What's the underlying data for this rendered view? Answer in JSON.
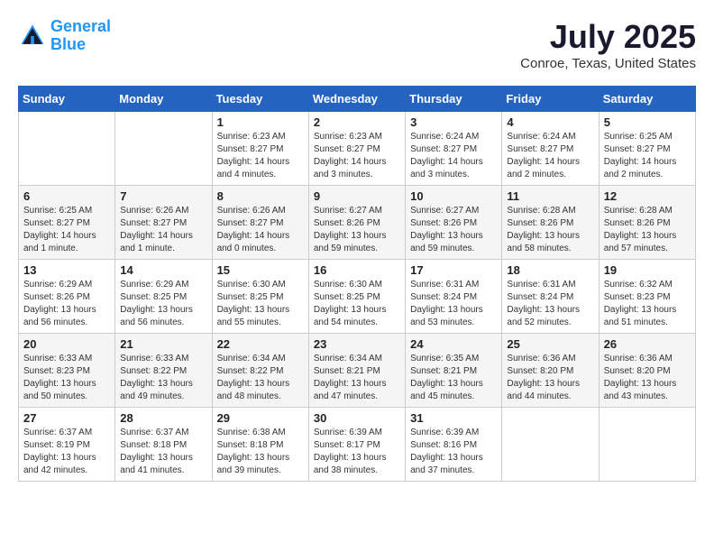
{
  "header": {
    "logo_line1": "General",
    "logo_line2": "Blue",
    "month_year": "July 2025",
    "location": "Conroe, Texas, United States"
  },
  "weekdays": [
    "Sunday",
    "Monday",
    "Tuesday",
    "Wednesday",
    "Thursday",
    "Friday",
    "Saturday"
  ],
  "weeks": [
    [
      {
        "day": "",
        "text": ""
      },
      {
        "day": "",
        "text": ""
      },
      {
        "day": "1",
        "text": "Sunrise: 6:23 AM\nSunset: 8:27 PM\nDaylight: 14 hours and 4 minutes."
      },
      {
        "day": "2",
        "text": "Sunrise: 6:23 AM\nSunset: 8:27 PM\nDaylight: 14 hours and 3 minutes."
      },
      {
        "day": "3",
        "text": "Sunrise: 6:24 AM\nSunset: 8:27 PM\nDaylight: 14 hours and 3 minutes."
      },
      {
        "day": "4",
        "text": "Sunrise: 6:24 AM\nSunset: 8:27 PM\nDaylight: 14 hours and 2 minutes."
      },
      {
        "day": "5",
        "text": "Sunrise: 6:25 AM\nSunset: 8:27 PM\nDaylight: 14 hours and 2 minutes."
      }
    ],
    [
      {
        "day": "6",
        "text": "Sunrise: 6:25 AM\nSunset: 8:27 PM\nDaylight: 14 hours and 1 minute."
      },
      {
        "day": "7",
        "text": "Sunrise: 6:26 AM\nSunset: 8:27 PM\nDaylight: 14 hours and 1 minute."
      },
      {
        "day": "8",
        "text": "Sunrise: 6:26 AM\nSunset: 8:27 PM\nDaylight: 14 hours and 0 minutes."
      },
      {
        "day": "9",
        "text": "Sunrise: 6:27 AM\nSunset: 8:26 PM\nDaylight: 13 hours and 59 minutes."
      },
      {
        "day": "10",
        "text": "Sunrise: 6:27 AM\nSunset: 8:26 PM\nDaylight: 13 hours and 59 minutes."
      },
      {
        "day": "11",
        "text": "Sunrise: 6:28 AM\nSunset: 8:26 PM\nDaylight: 13 hours and 58 minutes."
      },
      {
        "day": "12",
        "text": "Sunrise: 6:28 AM\nSunset: 8:26 PM\nDaylight: 13 hours and 57 minutes."
      }
    ],
    [
      {
        "day": "13",
        "text": "Sunrise: 6:29 AM\nSunset: 8:26 PM\nDaylight: 13 hours and 56 minutes."
      },
      {
        "day": "14",
        "text": "Sunrise: 6:29 AM\nSunset: 8:25 PM\nDaylight: 13 hours and 56 minutes."
      },
      {
        "day": "15",
        "text": "Sunrise: 6:30 AM\nSunset: 8:25 PM\nDaylight: 13 hours and 55 minutes."
      },
      {
        "day": "16",
        "text": "Sunrise: 6:30 AM\nSunset: 8:25 PM\nDaylight: 13 hours and 54 minutes."
      },
      {
        "day": "17",
        "text": "Sunrise: 6:31 AM\nSunset: 8:24 PM\nDaylight: 13 hours and 53 minutes."
      },
      {
        "day": "18",
        "text": "Sunrise: 6:31 AM\nSunset: 8:24 PM\nDaylight: 13 hours and 52 minutes."
      },
      {
        "day": "19",
        "text": "Sunrise: 6:32 AM\nSunset: 8:23 PM\nDaylight: 13 hours and 51 minutes."
      }
    ],
    [
      {
        "day": "20",
        "text": "Sunrise: 6:33 AM\nSunset: 8:23 PM\nDaylight: 13 hours and 50 minutes."
      },
      {
        "day": "21",
        "text": "Sunrise: 6:33 AM\nSunset: 8:22 PM\nDaylight: 13 hours and 49 minutes."
      },
      {
        "day": "22",
        "text": "Sunrise: 6:34 AM\nSunset: 8:22 PM\nDaylight: 13 hours and 48 minutes."
      },
      {
        "day": "23",
        "text": "Sunrise: 6:34 AM\nSunset: 8:21 PM\nDaylight: 13 hours and 47 minutes."
      },
      {
        "day": "24",
        "text": "Sunrise: 6:35 AM\nSunset: 8:21 PM\nDaylight: 13 hours and 45 minutes."
      },
      {
        "day": "25",
        "text": "Sunrise: 6:36 AM\nSunset: 8:20 PM\nDaylight: 13 hours and 44 minutes."
      },
      {
        "day": "26",
        "text": "Sunrise: 6:36 AM\nSunset: 8:20 PM\nDaylight: 13 hours and 43 minutes."
      }
    ],
    [
      {
        "day": "27",
        "text": "Sunrise: 6:37 AM\nSunset: 8:19 PM\nDaylight: 13 hours and 42 minutes."
      },
      {
        "day": "28",
        "text": "Sunrise: 6:37 AM\nSunset: 8:18 PM\nDaylight: 13 hours and 41 minutes."
      },
      {
        "day": "29",
        "text": "Sunrise: 6:38 AM\nSunset: 8:18 PM\nDaylight: 13 hours and 39 minutes."
      },
      {
        "day": "30",
        "text": "Sunrise: 6:39 AM\nSunset: 8:17 PM\nDaylight: 13 hours and 38 minutes."
      },
      {
        "day": "31",
        "text": "Sunrise: 6:39 AM\nSunset: 8:16 PM\nDaylight: 13 hours and 37 minutes."
      },
      {
        "day": "",
        "text": ""
      },
      {
        "day": "",
        "text": ""
      }
    ]
  ]
}
